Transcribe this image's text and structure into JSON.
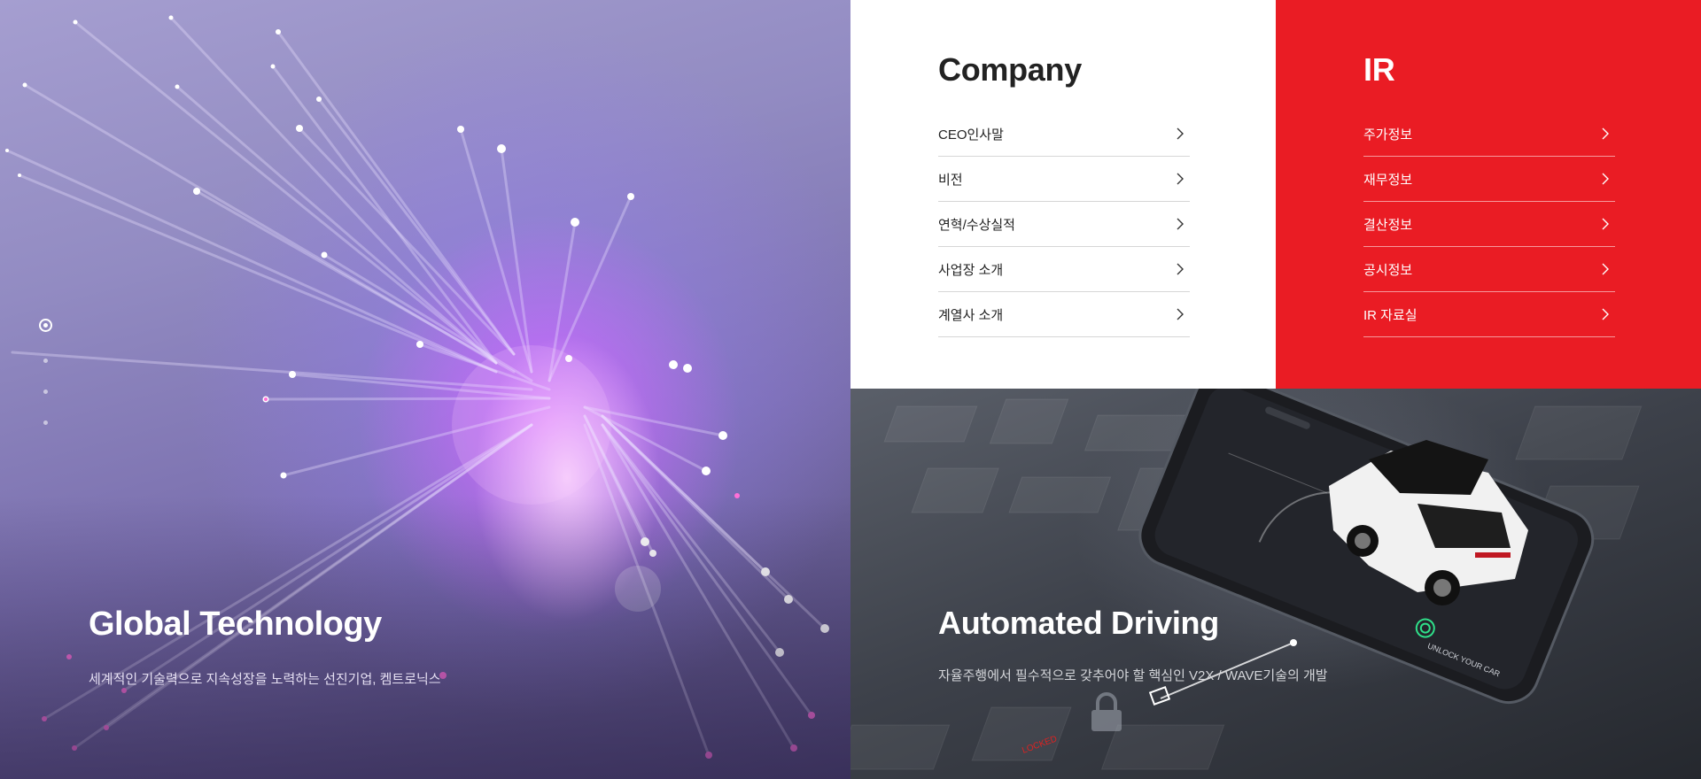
{
  "hero": {
    "title": "Global Technology",
    "description": "세계적인 기술력으로 지속성장을 노력하는 선진기업, 켐트로닉스",
    "pager_count": 4,
    "pager_active": 1
  },
  "company": {
    "heading": "Company",
    "items": [
      {
        "label": "CEO인사말"
      },
      {
        "label": "비전"
      },
      {
        "label": "연혁/수상실적"
      },
      {
        "label": "사업장 소개"
      },
      {
        "label": "계열사 소개"
      }
    ]
  },
  "ir": {
    "heading": "IR",
    "items": [
      {
        "label": "주가정보"
      },
      {
        "label": "재무정보"
      },
      {
        "label": "결산정보"
      },
      {
        "label": "공시정보"
      },
      {
        "label": "IR 자료실"
      }
    ]
  },
  "drive": {
    "title": "Automated Driving",
    "description": "자율주행에서 필수적으로 갖추어야 할 핵심인 V2X / WAVE기술의 개발",
    "phone_caption": "UNLOCK YOUR CAR"
  },
  "colors": {
    "ir_red": "#ea1c24",
    "company_bg": "#ffffff",
    "divider": "#d6d6d6"
  },
  "icons": [
    "chevron-right-icon",
    "lock-icon",
    "fingerprint-icon",
    "pager-dot-icon"
  ]
}
